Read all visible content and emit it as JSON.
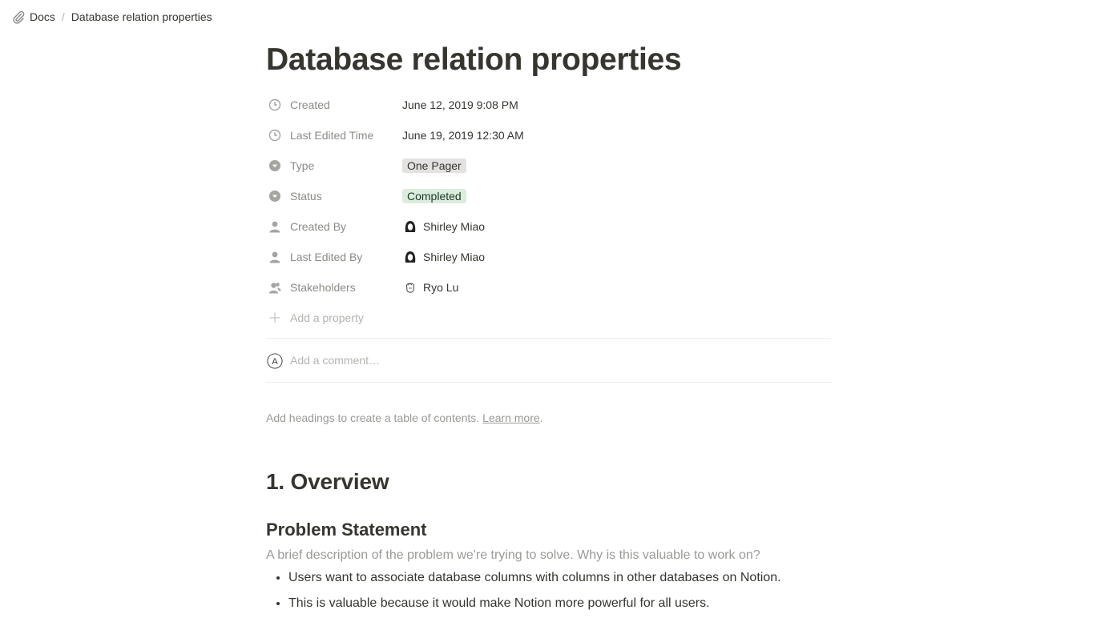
{
  "breadcrumb": {
    "icon": "paperclip-icon",
    "parent": "Docs",
    "separator": "/",
    "current": "Database relation properties"
  },
  "page": {
    "title": "Database relation properties",
    "properties": [
      {
        "key": "Created",
        "icon": "clock-icon",
        "value": "June 12, 2019 9:08 PM",
        "kind": "text"
      },
      {
        "key": "Last Edited Time",
        "icon": "clock-icon",
        "value": "June 19, 2019 12:30 AM",
        "kind": "text"
      },
      {
        "key": "Type",
        "icon": "select-icon",
        "value": "One Pager",
        "kind": "tag",
        "color": "#e3e2e0"
      },
      {
        "key": "Status",
        "icon": "select-icon",
        "value": "Completed",
        "kind": "tag",
        "color": "#dbeddb"
      },
      {
        "key": "Created By",
        "icon": "person-icon",
        "value": "Shirley Miao",
        "kind": "person"
      },
      {
        "key": "Last Edited By",
        "icon": "person-icon",
        "value": "Shirley Miao",
        "kind": "person"
      },
      {
        "key": "Stakeholders",
        "icon": "people-icon",
        "value": "Ryo Lu",
        "kind": "person"
      }
    ],
    "add_property": "Add a property",
    "comment_placeholder": "Add a comment…",
    "toc_hint": "Add headings to create a table of contents.",
    "toc_link": "Learn more",
    "heading1": "1. Overview",
    "heading3": "Problem Statement",
    "description": "A brief description of the problem we're trying to solve. Why is this valuable to work on?",
    "bullets": [
      "Users want to associate database columns with columns in other databases on Notion.",
      "This is valuable because it would make Notion more powerful for all users."
    ]
  }
}
